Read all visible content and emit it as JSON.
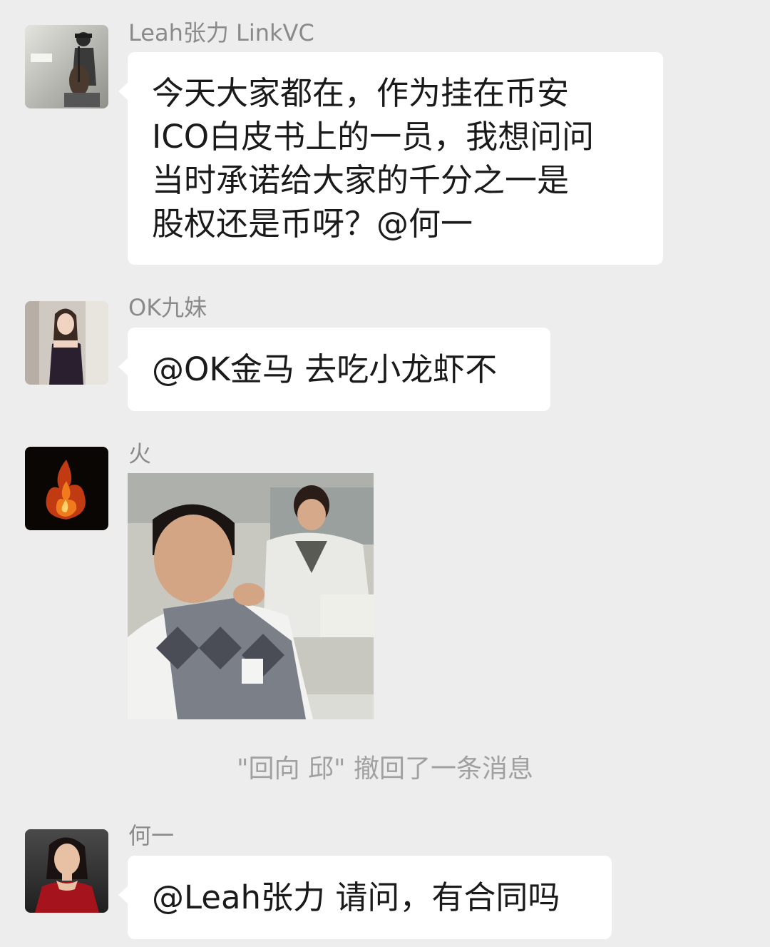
{
  "messages": [
    {
      "sender": "Leah张力 LinkVC",
      "avatar_icon": "cellist-photo-avatar",
      "text": "今天大家都在，作为挂在币安\nICO白皮书上的一员，我想问问\n当时承诺给大家的千分之一是\n股权还是币呀？@何一"
    },
    {
      "sender": "OK九妹",
      "avatar_icon": "woman-photo-avatar",
      "text": "@OK金马 去吃小龙虾不"
    },
    {
      "sender": "火",
      "avatar_icon": "flame-avatar",
      "sticker_icon": "movie-still-sticker"
    },
    {
      "sender": "何一",
      "avatar_icon": "woman-red-dress-avatar",
      "text": "@Leah张力 请问，有合同吗"
    }
  ],
  "system_notice": "\"回向 邱\" 撤回了一条消息",
  "colors": {
    "background": "#ededed",
    "bubble": "#ffffff",
    "sender_text": "#8a8a8a",
    "notice_text": "#a0a0a0"
  }
}
